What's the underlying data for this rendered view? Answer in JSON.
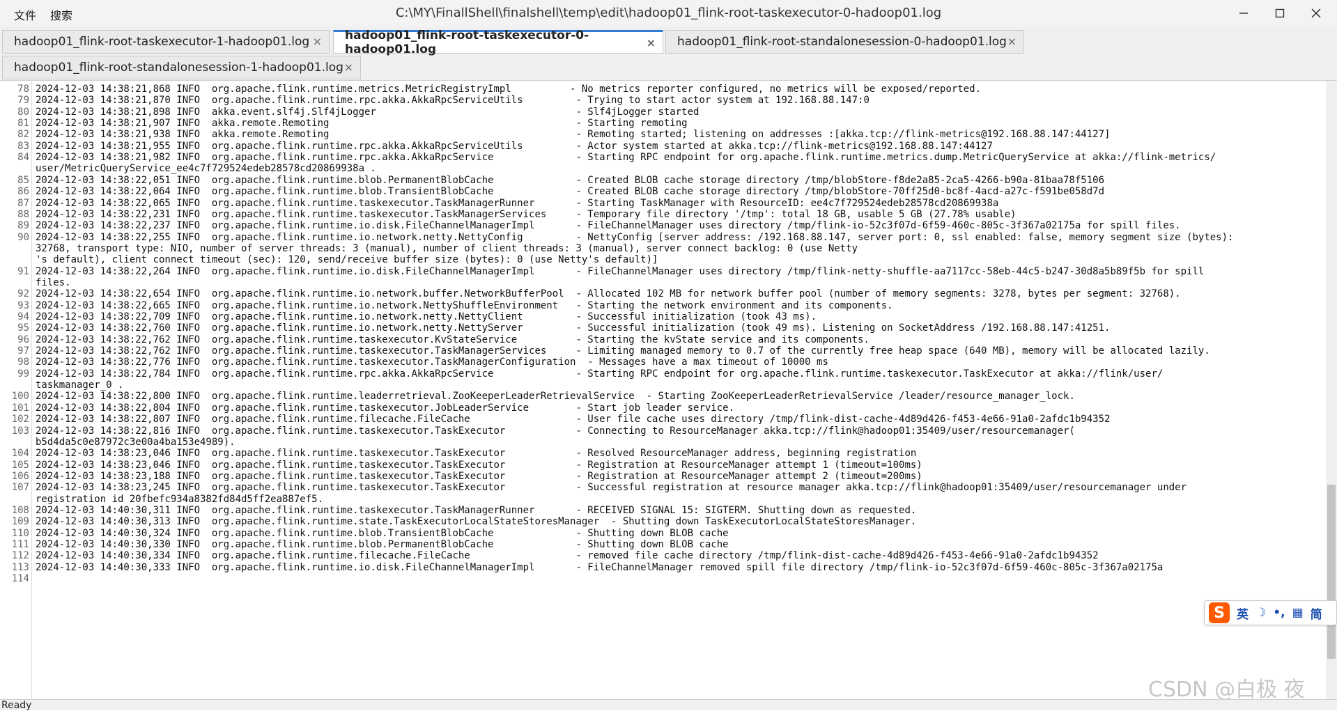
{
  "menu": {
    "file": "文件",
    "search": "搜索"
  },
  "window": {
    "title": "C:\\MY\\FinallShell\\finalshell\\temp\\edit\\hadoop01_flink-root-taskexecutor-0-hadoop01.log"
  },
  "tabs": [
    {
      "label": "hadoop01_flink-root-taskexecutor-1-hadoop01.log",
      "close": "×"
    },
    {
      "label": "hadoop01_flink-root-taskexecutor-0-hadoop01.log",
      "close": "×"
    },
    {
      "label": "hadoop01_flink-root-standalonesession-0-hadoop01.log",
      "close": "×"
    },
    {
      "label": "hadoop01_flink-root-standalonesession-1-hadoop01.log",
      "close": "×"
    }
  ],
  "active_tab_index": 1,
  "log_lines": [
    {
      "n": "78",
      "t": "2024-12-03 14:38:21,868 INFO  org.apache.flink.runtime.metrics.MetricRegistryImpl          - No metrics reporter configured, no metrics will be exposed/reported.",
      "rows": 1
    },
    {
      "n": "79",
      "t": "2024-12-03 14:38:21,870 INFO  org.apache.flink.runtime.rpc.akka.AkkaRpcServiceUtils         - Trying to start actor system at 192.168.88.147:0",
      "rows": 1
    },
    {
      "n": "80",
      "t": "2024-12-03 14:38:21,898 INFO  akka.event.slf4j.Slf4jLogger                                  - Slf4jLogger started",
      "rows": 1
    },
    {
      "n": "81",
      "t": "2024-12-03 14:38:21,907 INFO  akka.remote.Remoting                                          - Starting remoting",
      "rows": 1
    },
    {
      "n": "82",
      "t": "2024-12-03 14:38:21,938 INFO  akka.remote.Remoting                                          - Remoting started; listening on addresses :[akka.tcp://flink-metrics@192.168.88.147:44127]",
      "rows": 1
    },
    {
      "n": "83",
      "t": "2024-12-03 14:38:21,955 INFO  org.apache.flink.runtime.rpc.akka.AkkaRpcServiceUtils         - Actor system started at akka.tcp://flink-metrics@192.168.88.147:44127",
      "rows": 1
    },
    {
      "n": "84",
      "t": "2024-12-03 14:38:21,982 INFO  org.apache.flink.runtime.rpc.akka.AkkaRpcService              - Starting RPC endpoint for org.apache.flink.runtime.metrics.dump.MetricQueryService at akka://flink-metrics/\nuser/MetricQueryService_ee4c7f729524edeb28578cd20869938a .",
      "rows": 2
    },
    {
      "n": "85",
      "t": "2024-12-03 14:38:22,051 INFO  org.apache.flink.runtime.blob.PermanentBlobCache              - Created BLOB cache storage directory /tmp/blobStore-f8de2a85-2ca5-4266-b90a-81baa78f5106",
      "rows": 1
    },
    {
      "n": "86",
      "t": "2024-12-03 14:38:22,064 INFO  org.apache.flink.runtime.blob.TransientBlobCache              - Created BLOB cache storage directory /tmp/blobStore-70ff25d0-bc8f-4acd-a27c-f591be058d7d",
      "rows": 1
    },
    {
      "n": "87",
      "t": "2024-12-03 14:38:22,065 INFO  org.apache.flink.runtime.taskexecutor.TaskManagerRunner       - Starting TaskManager with ResourceID: ee4c7f729524edeb28578cd20869938a",
      "rows": 1
    },
    {
      "n": "88",
      "t": "2024-12-03 14:38:22,231 INFO  org.apache.flink.runtime.taskexecutor.TaskManagerServices     - Temporary file directory '/tmp': total 18 GB, usable 5 GB (27.78% usable)",
      "rows": 1
    },
    {
      "n": "89",
      "t": "2024-12-03 14:38:22,237 INFO  org.apache.flink.runtime.io.disk.FileChannelManagerImpl       - FileChannelManager uses directory /tmp/flink-io-52c3f07d-6f59-460c-805c-3f367a02175a for spill files.",
      "rows": 1
    },
    {
      "n": "90",
      "t": "2024-12-03 14:38:22,255 INFO  org.apache.flink.runtime.io.network.netty.NettyConfig         - NettyConfig [server address: /192.168.88.147, server port: 0, ssl enabled: false, memory segment size (bytes):\n32768, transport type: NIO, number of server threads: 3 (manual), number of client threads: 3 (manual), server connect backlog: 0 (use Netty\n's default), client connect timeout (sec): 120, send/receive buffer size (bytes): 0 (use Netty's default)]",
      "rows": 3
    },
    {
      "n": "91",
      "t": "2024-12-03 14:38:22,264 INFO  org.apache.flink.runtime.io.disk.FileChannelManagerImpl       - FileChannelManager uses directory /tmp/flink-netty-shuffle-aa7117cc-58eb-44c5-b247-30d8a5b89f5b for spill\nfiles.",
      "rows": 2
    },
    {
      "n": "92",
      "t": "2024-12-03 14:38:22,654 INFO  org.apache.flink.runtime.io.network.buffer.NetworkBufferPool  - Allocated 102 MB for network buffer pool (number of memory segments: 3278, bytes per segment: 32768).",
      "rows": 1
    },
    {
      "n": "93",
      "t": "2024-12-03 14:38:22,665 INFO  org.apache.flink.runtime.io.network.NettyShuffleEnvironment   - Starting the network environment and its components.",
      "rows": 1
    },
    {
      "n": "94",
      "t": "2024-12-03 14:38:22,709 INFO  org.apache.flink.runtime.io.network.netty.NettyClient         - Successful initialization (took 43 ms).",
      "rows": 1
    },
    {
      "n": "95",
      "t": "2024-12-03 14:38:22,760 INFO  org.apache.flink.runtime.io.network.netty.NettyServer         - Successful initialization (took 49 ms). Listening on SocketAddress /192.168.88.147:41251.",
      "rows": 1
    },
    {
      "n": "96",
      "t": "2024-12-03 14:38:22,762 INFO  org.apache.flink.runtime.taskexecutor.KvStateService          - Starting the kvState service and its components.",
      "rows": 1
    },
    {
      "n": "97",
      "t": "2024-12-03 14:38:22,762 INFO  org.apache.flink.runtime.taskexecutor.TaskManagerServices     - Limiting managed memory to 0.7 of the currently free heap space (640 MB), memory will be allocated lazily.",
      "rows": 1
    },
    {
      "n": "98",
      "t": "2024-12-03 14:38:22,776 INFO  org.apache.flink.runtime.taskexecutor.TaskManagerConfiguration  - Messages have a max timeout of 10000 ms",
      "rows": 1
    },
    {
      "n": "99",
      "t": "2024-12-03 14:38:22,784 INFO  org.apache.flink.runtime.rpc.akka.AkkaRpcService              - Starting RPC endpoint for org.apache.flink.runtime.taskexecutor.TaskExecutor at akka://flink/user/\ntaskmanager_0 .",
      "rows": 2
    },
    {
      "n": "100",
      "t": "2024-12-03 14:38:22,800 INFO  org.apache.flink.runtime.leaderretrieval.ZooKeeperLeaderRetrievalService  - Starting ZooKeeperLeaderRetrievalService /leader/resource_manager_lock.",
      "rows": 1
    },
    {
      "n": "101",
      "t": "2024-12-03 14:38:22,804 INFO  org.apache.flink.runtime.taskexecutor.JobLeaderService        - Start job leader service.",
      "rows": 1
    },
    {
      "n": "102",
      "t": "2024-12-03 14:38:22,807 INFO  org.apache.flink.runtime.filecache.FileCache                  - User file cache uses directory /tmp/flink-dist-cache-4d89d426-f453-4e66-91a0-2afdc1b94352",
      "rows": 1
    },
    {
      "n": "103",
      "t": "2024-12-03 14:38:22,816 INFO  org.apache.flink.runtime.taskexecutor.TaskExecutor            - Connecting to ResourceManager akka.tcp://flink@hadoop01:35409/user/resourcemanager(\nb5d4da5c0e87972c3e00a4ba153e4989).",
      "rows": 2
    },
    {
      "n": "104",
      "t": "2024-12-03 14:38:23,046 INFO  org.apache.flink.runtime.taskexecutor.TaskExecutor            - Resolved ResourceManager address, beginning registration",
      "rows": 1
    },
    {
      "n": "105",
      "t": "2024-12-03 14:38:23,046 INFO  org.apache.flink.runtime.taskexecutor.TaskExecutor            - Registration at ResourceManager attempt 1 (timeout=100ms)",
      "rows": 1
    },
    {
      "n": "106",
      "t": "2024-12-03 14:38:23,188 INFO  org.apache.flink.runtime.taskexecutor.TaskExecutor            - Registration at ResourceManager attempt 2 (timeout=200ms)",
      "rows": 1
    },
    {
      "n": "107",
      "t": "2024-12-03 14:38:23,245 INFO  org.apache.flink.runtime.taskexecutor.TaskExecutor            - Successful registration at resource manager akka.tcp://flink@hadoop01:35409/user/resourcemanager under\nregistration id 20fbefc934a8382fd84d5ff2ea887ef5.",
      "rows": 2
    },
    {
      "n": "108",
      "t": "2024-12-03 14:40:30,311 INFO  org.apache.flink.runtime.taskexecutor.TaskManagerRunner       - RECEIVED SIGNAL 15: SIGTERM. Shutting down as requested.",
      "rows": 1
    },
    {
      "n": "109",
      "t": "2024-12-03 14:40:30,313 INFO  org.apache.flink.runtime.state.TaskExecutorLocalStateStoresManager  - Shutting down TaskExecutorLocalStateStoresManager.",
      "rows": 1
    },
    {
      "n": "110",
      "t": "2024-12-03 14:40:30,324 INFO  org.apache.flink.runtime.blob.TransientBlobCache              - Shutting down BLOB cache",
      "rows": 1
    },
    {
      "n": "111",
      "t": "2024-12-03 14:40:30,330 INFO  org.apache.flink.runtime.blob.PermanentBlobCache              - Shutting down BLOB cache",
      "rows": 1
    },
    {
      "n": "112",
      "t": "2024-12-03 14:40:30,334 INFO  org.apache.flink.runtime.filecache.FileCache                  - removed file cache directory /tmp/flink-dist-cache-4d89d426-f453-4e66-91a0-2afdc1b94352",
      "rows": 1
    },
    {
      "n": "113",
      "t": "2024-12-03 14:40:30,333 INFO  org.apache.flink.runtime.io.disk.FileChannelManagerImpl       - FileChannelManager removed spill file directory /tmp/flink-io-52c3f07d-6f59-460c-805c-3f367a02175a",
      "rows": 1
    },
    {
      "n": "114",
      "t": "",
      "rows": 1
    }
  ],
  "status": {
    "text": "Ready"
  },
  "ime": {
    "logo": "S",
    "items": [
      "英",
      "☽",
      "•,",
      "▦",
      "简"
    ]
  },
  "watermark": "CSDN @白极 夜",
  "colors": {
    "accent": "#2f7bd6",
    "ime_orange": "#ff5a00",
    "ime_blue": "#1b4fb0"
  },
  "icons": {
    "minimize": "minimize-icon",
    "maximize": "maximize-icon",
    "close": "close-icon"
  }
}
